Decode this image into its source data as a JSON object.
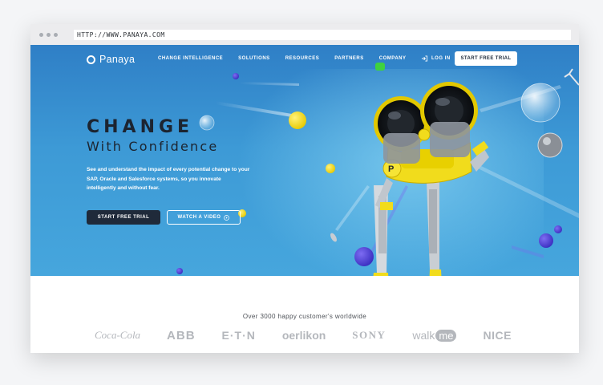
{
  "browser": {
    "url": "HTTP://WWW.PANAYA.COM"
  },
  "nav": {
    "logo": "Panaya",
    "menu": [
      {
        "label": "CHANGE INTELLIGENCE"
      },
      {
        "label": "SOLUTIONS"
      },
      {
        "label": "RESOURCES"
      },
      {
        "label": "PARTNERS"
      },
      {
        "label": "COMPANY"
      }
    ],
    "login": "LOG IN",
    "login_icon": "login-arrow-icon",
    "cta": "START FREE TRIAL"
  },
  "hero": {
    "headline": "CHANGE",
    "subheadline": "With Confidence",
    "description": "See and understand the impact of every potential change to your SAP, Oracle and Salesforce systems, so you innovate intelligently and without fear.",
    "primary_button": "START FREE TRIAL",
    "secondary_button": "WATCH A VIDEO",
    "secondary_icon": "play-circle-icon"
  },
  "customers": {
    "tagline": "Over 3000 happy customer's worldwide",
    "logos": {
      "coke": "Coca-Cola",
      "abb": "ABB",
      "eaton": "E·T·N",
      "oerlikon": "oerlikon",
      "sony": "SONY",
      "walk": "walk",
      "me": "me",
      "nice": "NICE"
    }
  },
  "colors": {
    "hero_blue": "#3d9ad6",
    "navy": "#1f2a3a",
    "accent_yellow": "#f1dc1c",
    "logo_gray": "#b4b7bc"
  }
}
